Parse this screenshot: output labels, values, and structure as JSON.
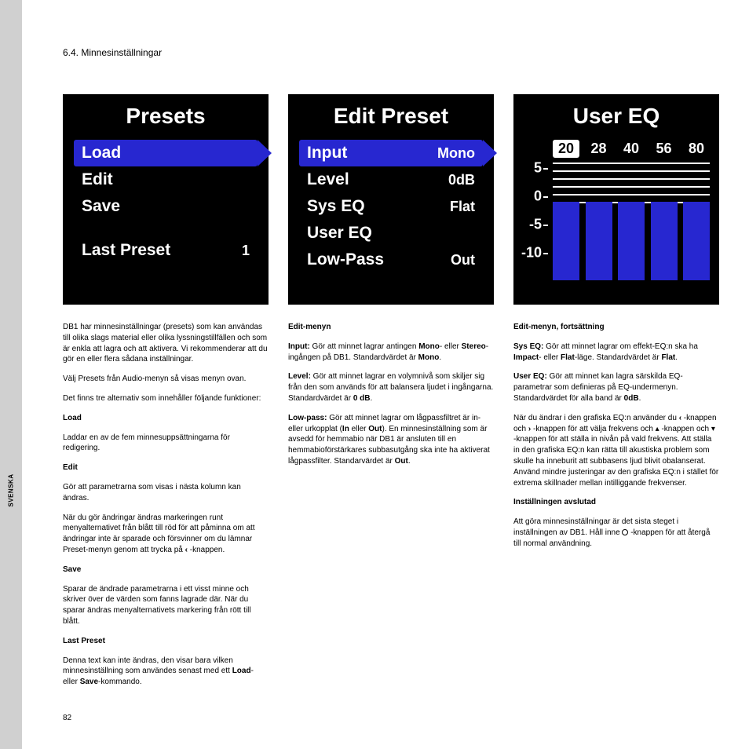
{
  "header": {
    "section": "6.4. Minnesinställningar"
  },
  "sideTab": "SVENSKA",
  "pageNumber": "82",
  "screen1": {
    "title": "Presets",
    "items": [
      {
        "label": "Load",
        "highlight": true
      },
      {
        "label": "Edit"
      },
      {
        "label": "Save"
      }
    ],
    "lastPreset": {
      "label": "Last Preset",
      "value": "1"
    }
  },
  "screen2": {
    "title": "Edit Preset",
    "items": [
      {
        "label": "Input",
        "value": "Mono",
        "highlight": true
      },
      {
        "label": "Level",
        "value": "0dB"
      },
      {
        "label": "Sys EQ",
        "value": "Flat"
      },
      {
        "label": "User EQ",
        "value": ""
      },
      {
        "label": "Low-Pass",
        "value": "Out"
      }
    ]
  },
  "screen3": {
    "title": "User EQ",
    "freqs": [
      "20",
      "28",
      "40",
      "56",
      "80"
    ],
    "selectedFreqIndex": 0,
    "yLabels": [
      "5",
      "0",
      "-5",
      "-10"
    ]
  },
  "col1": {
    "p1": "DB1 har minnesinställningar (presets) som kan användas till olika slags material eller olika lyssningstillfällen och som är enkla att lagra och att aktivera. Vi rekommenderar att du gör en eller flera sådana inställningar.",
    "p2": "Välj Presets från Audio-menyn så visas menyn ovan.",
    "p3": "Det finns tre alternativ som innehåller följande funktioner:",
    "load_h": "Load",
    "load_t": "Laddar en av de fem minnesuppsättningarna för redigering.",
    "edit_h": "Edit",
    "edit_t1": "Gör att parametrarna som visas i nästa kolumn kan ändras.",
    "edit_t2a": "När du gör ändringar ändras markeringen runt menyalternativet från blått till röd för att påminna om att ändringar inte är sparade och försvinner om du lämnar Preset-menyn genom att trycka på ",
    "edit_t2b": " -knappen.",
    "save_h": "Save",
    "save_t": "Sparar de ändrade parametrarna i ett visst minne och skriver över de värden som fanns lagrade där. När du sparar ändras menyalternativets markering från rött till blått.",
    "last_h": "Last Preset",
    "last_t1": "Denna text kan inte ändras, den visar bara vilken minnesinställning som användes senast med ett ",
    "last_b1": "Load",
    "last_t2": "- eller ",
    "last_b2": "Save",
    "last_t3": "-kommando."
  },
  "col2": {
    "h": "Edit-menyn",
    "input_l": "Input:",
    "input_t1": " Gör att minnet lagrar antingen ",
    "input_b1": "Mono",
    "input_t2": "- eller ",
    "input_b2": "Stereo",
    "input_t3": "-ingången på DB1. Standardvärdet är ",
    "input_b3": "Mono",
    "input_t4": ".",
    "level_l": "Level:",
    "level_t1": " Gör att minnet lagrar en volymnivå som skiljer sig från den som används för att balansera ljudet i ingångarna. Standardvärdet är ",
    "level_b1": "0 dB",
    "level_t2": ".",
    "low_l": "Low-pass:",
    "low_t1": " Gör att minnet lagrar om lågpassfiltret är in- eller urkopplat (",
    "low_b1": "In",
    "low_t2": " eller ",
    "low_b2": "Out",
    "low_t3": "). En minnesinställning som är avsedd för hemmabio när DB1 är ansluten till en hemmabioförstärkares subbasutgång ska inte ha aktiverat lågpassfilter. Standarvärdet är ",
    "low_b3": "Out",
    "low_t4": "."
  },
  "col3": {
    "h": "Edit-menyn, fortsättning",
    "sys_l": "Sys EQ:",
    "sys_t1": " Gör att minnet lagrar om effekt-EQ:n ska ha ",
    "sys_b1": "Impact",
    "sys_t2": "- eller ",
    "sys_b2": "Flat",
    "sys_t3": "-läge. Standardvärdet är ",
    "sys_b3": "Flat",
    "sys_t4": ".",
    "user_l": "User EQ:",
    "user_t1": " Gör att minnet kan lagra särskilda EQ-parametrar som definieras på EQ-undermenyn. Standardvärdet för alla band är ",
    "user_b1": "0dB",
    "user_t2": ".",
    "nav_t1": "När du ändrar i den grafiska EQ:n använder du ",
    "nav_t2": " -knappen och ",
    "nav_t3": " -knappen för att välja frekvens och ",
    "nav_t4": " -knappen och ",
    "nav_t5": " -knappen för att ställa in nivån på vald frekvens. Att ställa in den grafiska EQ:n kan rätta till akustiska problem som skulle ha inneburit att subbasens ljud blivit obalanserat. Använd mindre justeringar av den grafiska EQ:n i stället för extrema skillnader mellan intilliggande frekvenser.",
    "done_h": "Inställningen avslutad",
    "done_t1": "Att göra minnesinställningar är det sista steget i inställningen av DB1. Håll inne ",
    "done_t2": " -knappen för att återgå till normal användning."
  }
}
